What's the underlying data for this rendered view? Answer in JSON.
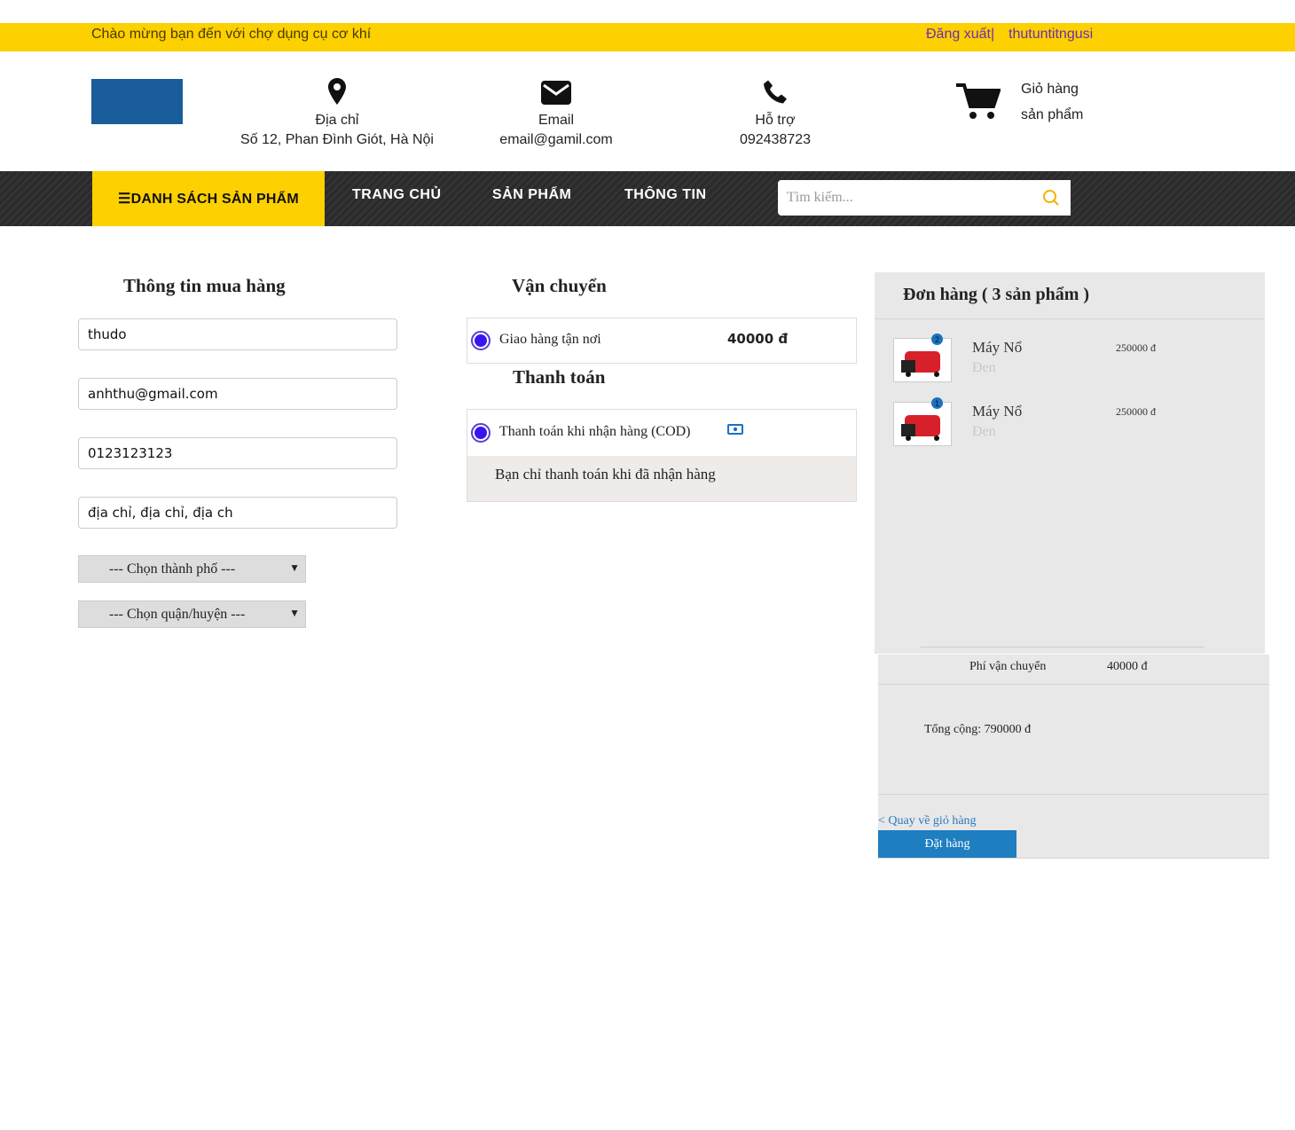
{
  "topbar": {
    "welcome": "Chào mừng bạn đến với chợ dụng cụ cơ khí",
    "logout": "Đăng xuất|",
    "username": "thutuntitngusi"
  },
  "header": {
    "address": {
      "icon": "map-marker-icon",
      "label": "Địa chỉ",
      "value": "Số 12, Phan Đình Giót, Hà Nội"
    },
    "email": {
      "icon": "envelope-icon",
      "label": "Email",
      "value": "email@gamil.com"
    },
    "support": {
      "icon": "phone-icon",
      "label": "Hỗ trợ",
      "value": "092438723"
    },
    "cart": {
      "icon": "cart-icon",
      "line1": "Giỏ hàng",
      "line2": "sản phẩm"
    }
  },
  "nav": {
    "categories": "☰DANH SÁCH SẢN PHẨM",
    "home": "TRANG CHỦ",
    "products": "SẢN PHẨM",
    "info": "THÔNG TIN",
    "search_placeholder": "Tìm kiếm..."
  },
  "purchase": {
    "title": "Thông tin mua hàng",
    "name": "thudo",
    "email": "anhthu@gmail.com",
    "phone": "0123123123",
    "address": "địa chỉ, địa chỉ, địa ch",
    "city": "--- Chọn thành phố ---",
    "district": "--- Chọn quận/huyện ---"
  },
  "shipping": {
    "title": "Vận chuyển",
    "option": "Giao hàng tận nơi",
    "price": "40000 đ"
  },
  "payment": {
    "title": "Thanh toán",
    "option": "Thanh toán khi nhận hàng (COD)",
    "note": "Bạn chỉ thanh toán khi đã nhận hàng"
  },
  "order": {
    "title": "Đơn hàng ( 3 sản phẩm )",
    "items": [
      {
        "name": "Máy Nổ",
        "variant": "Đen",
        "price": "250000 đ",
        "qty": "2"
      },
      {
        "name": "Máy Nổ",
        "variant": "Đen",
        "price": "250000 đ",
        "qty": "1"
      }
    ],
    "shipping_label": "Phí vận chuyển",
    "shipping_value": "40000 đ",
    "total": "Tổng cộng: 790000 đ",
    "back": "< Quay về giỏ hàng",
    "submit": "Đặt hàng"
  },
  "colors": {
    "accent": "#fdd000",
    "nav": "#2a2a2a",
    "button": "#1f7ec0",
    "radio": "#3a14f0",
    "logo": "#1a5d9b"
  }
}
